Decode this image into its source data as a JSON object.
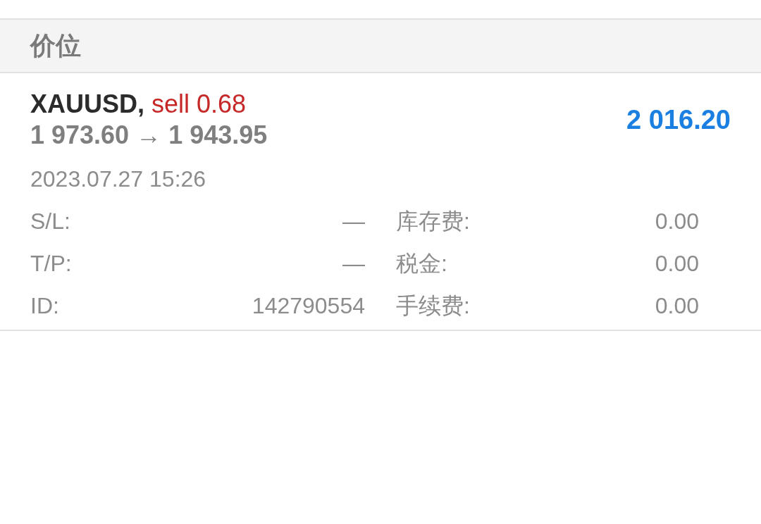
{
  "section": {
    "title": "价位"
  },
  "position": {
    "symbol": "XAUUSD,",
    "order": "sell 0.68",
    "prices": "1 973.60 → 1 943.95",
    "profit": "2 016.20",
    "time": "2023.07.27 15:26",
    "details": [
      {
        "label": "S/L:",
        "value": "—"
      },
      {
        "label": "库存费:",
        "value": "0.00"
      },
      {
        "label": "T/P:",
        "value": "—"
      },
      {
        "label": "税金:",
        "value": "0.00"
      },
      {
        "label": "ID:",
        "value": "142790554"
      },
      {
        "label": "手续费:",
        "value": "0.00"
      }
    ]
  }
}
